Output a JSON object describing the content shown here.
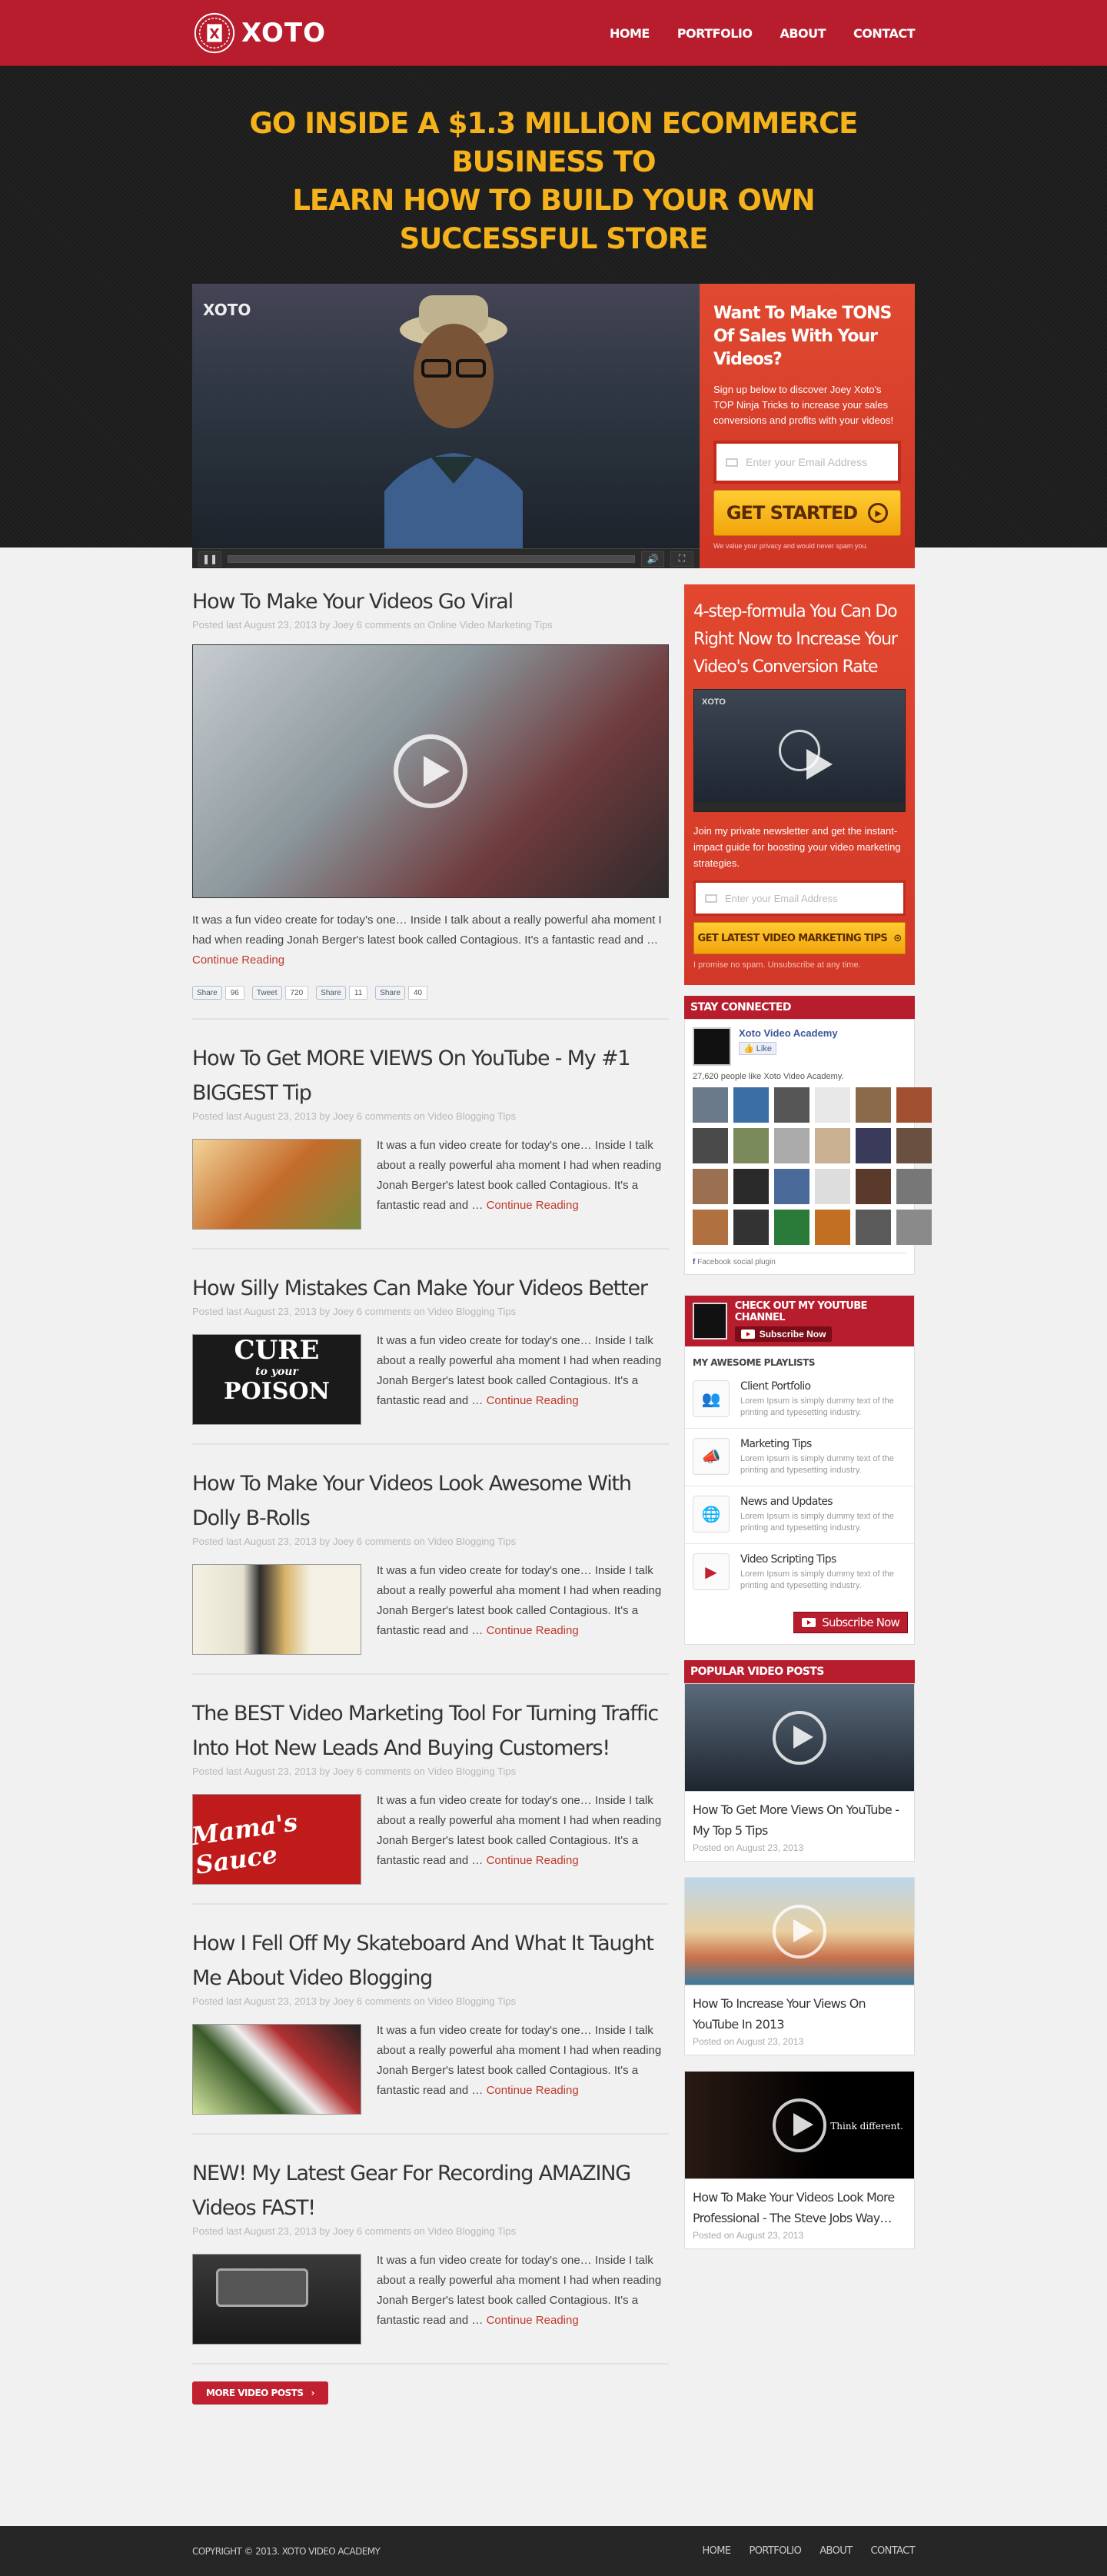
{
  "brand": {
    "name": "XOTO",
    "seal_letter": "X"
  },
  "nav": [
    "HOME",
    "PORTFOLIO",
    "ABOUT",
    "CONTACT"
  ],
  "hero": {
    "headline_1": "GO INSIDE A $1.3 MILLION ECOMMERCE BUSINESS TO",
    "headline_2": "LEARN HOW TO BUILD YOUR OWN SUCCESSFUL STORE",
    "video_watermark": "XOTO",
    "optin_title": "Want To Make TONS Of Sales With Your Videos?",
    "optin_text": "Sign up below to discover Joey Xoto's TOP Ninja Tricks to increase your sales conversions and profits with your videos!",
    "email_placeholder": "Enter your Email Address",
    "cta": "GET STARTED",
    "privacy": "We value your privacy and would never spam you."
  },
  "posts": [
    {
      "title": "How To Make Your Videos Go Viral",
      "meta": "Posted last August 23, 2013 by Joey 6 comments on Online Video Marketing Tips",
      "excerpt": "It was a fun video create for today's one… Inside I talk about a really powerful aha moment I had when reading Jonah Berger's latest book called Contagious. It's a fantastic read and … ",
      "more": "Continue Reading"
    },
    {
      "title": "How To Get MORE VIEWS On YouTube - My #1 BIGGEST Tip",
      "meta": "Posted last August 23, 2013 by Joey 6 comments on Video Blogging Tips",
      "excerpt": "It was a fun video create for today's one… Inside I talk about a really powerful aha moment I had when reading Jonah Berger's latest book called Contagious. It's a fantastic read and … ",
      "more": "Continue Reading"
    },
    {
      "title": "How Silly Mistakes Can Make Your Videos Better",
      "meta": "Posted last August 23, 2013 by Joey 6 comments on Video Blogging Tips",
      "excerpt": "It was a fun video create for today's one… Inside I talk about a really powerful aha moment I had when reading Jonah Berger's latest book called Contagious. It's a fantastic read and … ",
      "more": "Continue Reading"
    },
    {
      "title": "How To Make Your Videos Look Awesome With Dolly B-Rolls",
      "meta": "Posted last August 23, 2013 by Joey 6 comments on Video Blogging Tips",
      "excerpt": "It was a fun video create for today's one… Inside I talk about a really powerful aha moment I had when reading Jonah Berger's latest book called Contagious. It's a fantastic read and … ",
      "more": "Continue Reading"
    },
    {
      "title": "The BEST Video Marketing Tool For Turning Traffic Into Hot New Leads And Buying Customers!",
      "meta": "Posted last August 23, 2013 by Joey 6 comments on Video Blogging Tips",
      "excerpt": "It was a fun video create for today's one… Inside I talk about a really powerful aha moment I had when reading Jonah Berger's latest book called Contagious. It's a fantastic read and … ",
      "more": "Continue Reading"
    },
    {
      "title": "How I Fell Off My Skateboard And What It Taught Me About Video Blogging",
      "meta": "Posted last August 23, 2013 by Joey 6 comments on Video Blogging Tips",
      "excerpt": "It was a fun video create for today's one… Inside I talk about a really powerful aha moment I had when reading Jonah Berger's latest book called Contagious. It's a fantastic read and … ",
      "more": "Continue Reading"
    },
    {
      "title": "NEW! My Latest Gear For Recording AMAZING Videos FAST!",
      "meta": "Posted last August 23, 2013 by Joey 6 comments on Video Blogging Tips",
      "excerpt": "It was a fun video create for today's one… Inside I talk about a really powerful aha moment I had when reading Jonah Berger's latest book called Contagious. It's a fantastic read and … ",
      "more": "Continue Reading"
    }
  ],
  "share": {
    "fb": "Share",
    "fb_count": "96",
    "tw": "Tweet",
    "tw_count": "720",
    "gp": "Share",
    "gp_count": "11",
    "in": "Share",
    "in_count": "40"
  },
  "thumb_text": {
    "p3_line1": "CURE",
    "p3_line2": "to your",
    "p3_line3": "POISON",
    "p5": "Mama's Sauce"
  },
  "more_posts": "MORE VIDEO POSTS",
  "sidebar": {
    "formula_title": "4-step-formula You Can Do Right Now to Increase Your Video's Conversion Rate",
    "formula_text": "Join my private newsletter and get the instant-impact guide for boosting your video marketing  strategies.",
    "formula_email": "Enter your Email Address",
    "formula_btn": "GET LATEST VIDEO MARKETING TIPS",
    "formula_note": "I promise no spam. Unsubscribe at any time.",
    "stay_connected": "STAY CONNECTED",
    "fb_page": "Xoto Video Academy",
    "fb_like": "Like",
    "fb_count": "27,620 people like Xoto Video Academy.",
    "fb_plugin": "Facebook social plugin",
    "yt_title": "CHECK OUT MY YOUTUBE CHANNEL",
    "yt_sub": "Subscribe Now",
    "playlists_title": "MY AWESOME PLAYLISTS",
    "playlists": [
      {
        "name": "Client Portfolio",
        "desc": "Lorem Ipsum is simply dummy text of the printing and typesetting industry.",
        "icon": "users-icon"
      },
      {
        "name": "Marketing Tips",
        "desc": "Lorem Ipsum is simply dummy text of the printing and typesetting industry.",
        "icon": "megaphone-icon"
      },
      {
        "name": "News and Updates",
        "desc": "Lorem Ipsum is simply dummy text of the printing and typesetting industry.",
        "icon": "globe-icon"
      },
      {
        "name": "Video Scripting Tips",
        "desc": "Lorem Ipsum is simply dummy text of the printing and typesetting industry.",
        "icon": "video-icon"
      }
    ],
    "yt_sub_big": "Subscribe Now",
    "popular_title": "POPULAR VIDEO POSTS",
    "popular": [
      {
        "title": "How To Get More Views On YouTube - My Top 5 Tips",
        "date": "Posted on August 23, 2013"
      },
      {
        "title": "How To Increase Your Views On YouTube In 2013",
        "date": "Posted on August 23, 2013"
      },
      {
        "title": "How To Make Your Videos Look More Professional - The Steve Jobs Way…",
        "date": "Posted on August 23, 2013",
        "overlay": "Think different."
      }
    ]
  },
  "footer": {
    "copyright": "COPYRIGHT © 2013. XOTO VIDEO ACADEMY",
    "nav": [
      "HOME",
      "PORTFOLIO",
      "ABOUT",
      "CONTACT"
    ]
  },
  "colors": {
    "primary": "#b81d2e",
    "accent": "#f5b21a",
    "optin": "#d53a2a"
  }
}
